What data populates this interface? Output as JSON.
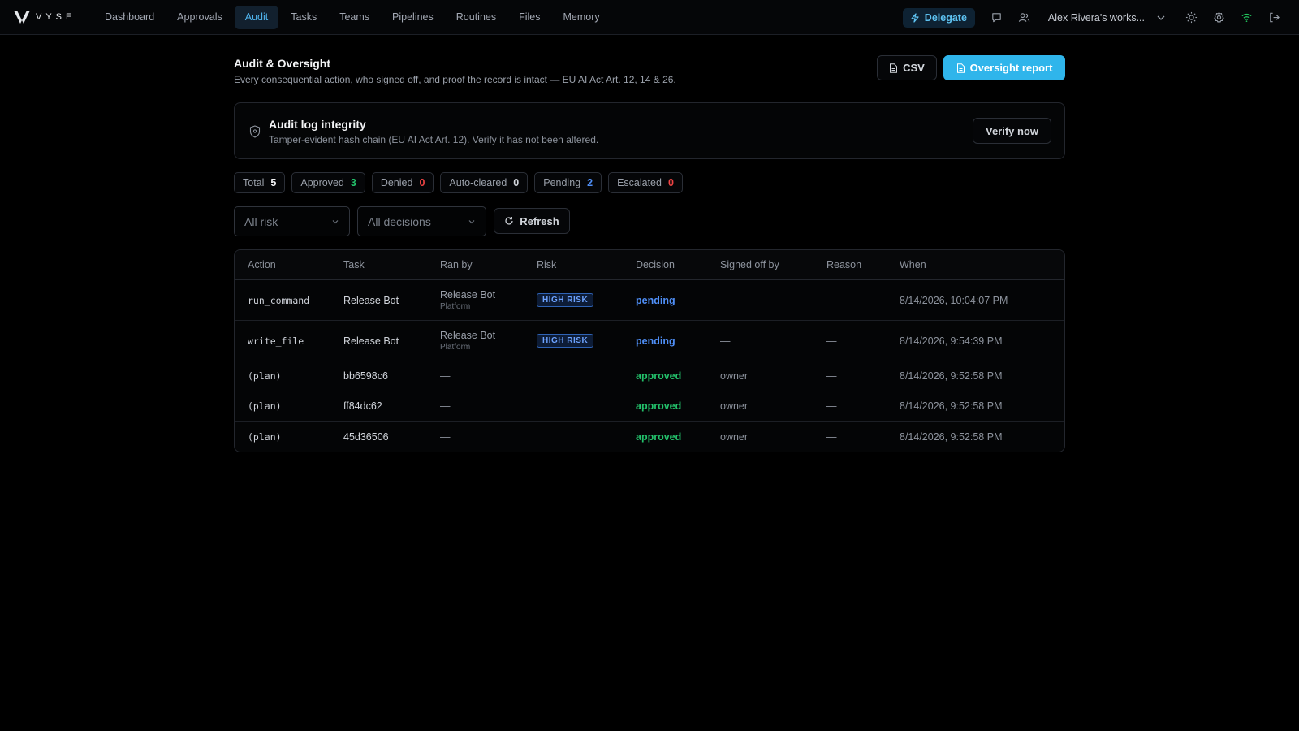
{
  "brand": {
    "name": "VYSE"
  },
  "nav": {
    "items": [
      {
        "label": "Dashboard",
        "active": false
      },
      {
        "label": "Approvals",
        "active": false
      },
      {
        "label": "Audit",
        "active": true
      },
      {
        "label": "Tasks",
        "active": false
      },
      {
        "label": "Teams",
        "active": false
      },
      {
        "label": "Pipelines",
        "active": false
      },
      {
        "label": "Routines",
        "active": false
      },
      {
        "label": "Files",
        "active": false
      },
      {
        "label": "Memory",
        "active": false
      }
    ],
    "delegate_label": "Delegate",
    "workspace_label": "Alex Rivera's works..."
  },
  "page": {
    "title": "Audit & Oversight",
    "subtitle": "Every consequential action, who signed off, and proof the record is intact — EU AI Act Art. 12, 14 & 26.",
    "csv_label": "CSV",
    "report_label": "Oversight report"
  },
  "integrity": {
    "title": "Audit log integrity",
    "subtitle": "Tamper-evident hash chain (EU AI Act Art. 12). Verify it has not been altered.",
    "verify_label": "Verify now"
  },
  "stats": [
    {
      "label": "Total",
      "value": "5",
      "color": "#f3f4f6"
    },
    {
      "label": "Approved",
      "value": "3",
      "color": "#23c26b"
    },
    {
      "label": "Denied",
      "value": "0",
      "color": "#ef4444"
    },
    {
      "label": "Auto-cleared",
      "value": "0",
      "color": "#d1d5db"
    },
    {
      "label": "Pending",
      "value": "2",
      "color": "#4f8ff7"
    },
    {
      "label": "Escalated",
      "value": "0",
      "color": "#ef4444"
    }
  ],
  "filters": {
    "risk_value": "All risk",
    "decision_value": "All decisions",
    "refresh_label": "Refresh"
  },
  "table": {
    "headers": {
      "action": "Action",
      "task": "Task",
      "ran_by": "Ran by",
      "risk": "Risk",
      "decision": "Decision",
      "signed_off_by": "Signed off by",
      "reason": "Reason",
      "when": "When"
    },
    "rows": [
      {
        "action": "run_command",
        "task": "Release Bot",
        "ran_by": "Release Bot",
        "ran_by_sub": "Platform",
        "risk": "HIGH RISK",
        "decision": "pending",
        "signed_off_by": "—",
        "reason": "—",
        "when": "8/14/2026, 10:04:07 PM"
      },
      {
        "action": "write_file",
        "task": "Release Bot",
        "ran_by": "Release Bot",
        "ran_by_sub": "Platform",
        "risk": "HIGH RISK",
        "decision": "pending",
        "signed_off_by": "—",
        "reason": "—",
        "when": "8/14/2026, 9:54:39 PM"
      },
      {
        "action": "(plan)",
        "task": "bb6598c6",
        "ran_by": "—",
        "ran_by_sub": "",
        "risk": "",
        "decision": "approved",
        "signed_off_by": "owner",
        "reason": "—",
        "when": "8/14/2026, 9:52:58 PM"
      },
      {
        "action": "(plan)",
        "task": "ff84dc62",
        "ran_by": "—",
        "ran_by_sub": "",
        "risk": "",
        "decision": "approved",
        "signed_off_by": "owner",
        "reason": "—",
        "when": "8/14/2026, 9:52:58 PM"
      },
      {
        "action": "(plan)",
        "task": "45d36506",
        "ran_by": "—",
        "ran_by_sub": "",
        "risk": "",
        "decision": "approved",
        "signed_off_by": "owner",
        "reason": "—",
        "when": "8/14/2026, 9:52:58 PM"
      }
    ]
  },
  "colors": {
    "accent": "#2fb5eb",
    "pending": "#4f8ff7",
    "approved": "#23c26b",
    "danger": "#ef4444",
    "connected": "#22c55e"
  },
  "icons": [
    "logo-mark",
    "bolt-icon",
    "chat-icon",
    "users-icon",
    "chevron-down-icon",
    "sun-icon",
    "gear-icon",
    "wifi-icon",
    "logout-icon",
    "file-icon",
    "shield-icon",
    "refresh-icon"
  ]
}
